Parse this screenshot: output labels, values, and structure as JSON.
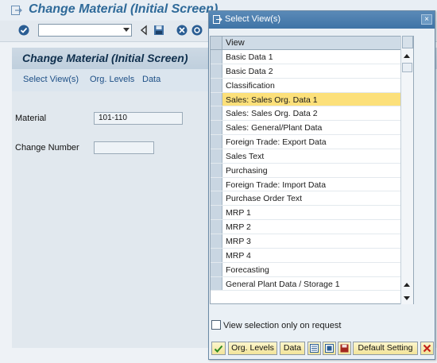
{
  "window": {
    "title": "Change Material (Initial Screen)"
  },
  "screen": {
    "title": "Change Material (Initial Screen)",
    "toolbar_buttons": [
      "Select View(s)",
      "Org. Levels",
      "Data"
    ]
  },
  "form": {
    "material_label": "Material",
    "material_value": "101-110",
    "change_number_label": "Change Number",
    "change_number_value": ""
  },
  "popup": {
    "title": "Select View(s)",
    "close_glyph": "×",
    "column_header": "View",
    "views": [
      {
        "label": "Basic Data 1",
        "selected": false
      },
      {
        "label": "Basic Data 2",
        "selected": false
      },
      {
        "label": "Classification",
        "selected": false
      },
      {
        "label": "Sales: Sales Org. Data 1",
        "selected": true
      },
      {
        "label": "Sales: Sales Org. Data 2",
        "selected": false
      },
      {
        "label": "Sales: General/Plant Data",
        "selected": false
      },
      {
        "label": "Foreign Trade: Export Data",
        "selected": false
      },
      {
        "label": "Sales Text",
        "selected": false
      },
      {
        "label": "Purchasing",
        "selected": false
      },
      {
        "label": "Foreign Trade: Import Data",
        "selected": false
      },
      {
        "label": "Purchase Order Text",
        "selected": false
      },
      {
        "label": "MRP 1",
        "selected": false
      },
      {
        "label": "MRP 2",
        "selected": false
      },
      {
        "label": "MRP 3",
        "selected": false
      },
      {
        "label": "MRP 4",
        "selected": false
      },
      {
        "label": "Forecasting",
        "selected": false
      },
      {
        "label": "General Plant Data / Storage 1",
        "selected": false
      }
    ],
    "option_label": "View selection only on request",
    "option_checked": false,
    "footer": {
      "org_levels": "Org. Levels",
      "data": "Data",
      "default_setting": "Default Setting"
    }
  },
  "colors": {
    "title_blue": "#2f6a99",
    "popup_title_bg": "#4a7fb0",
    "selected_row": "#fce07a",
    "footer_button": "#f2e49a"
  }
}
